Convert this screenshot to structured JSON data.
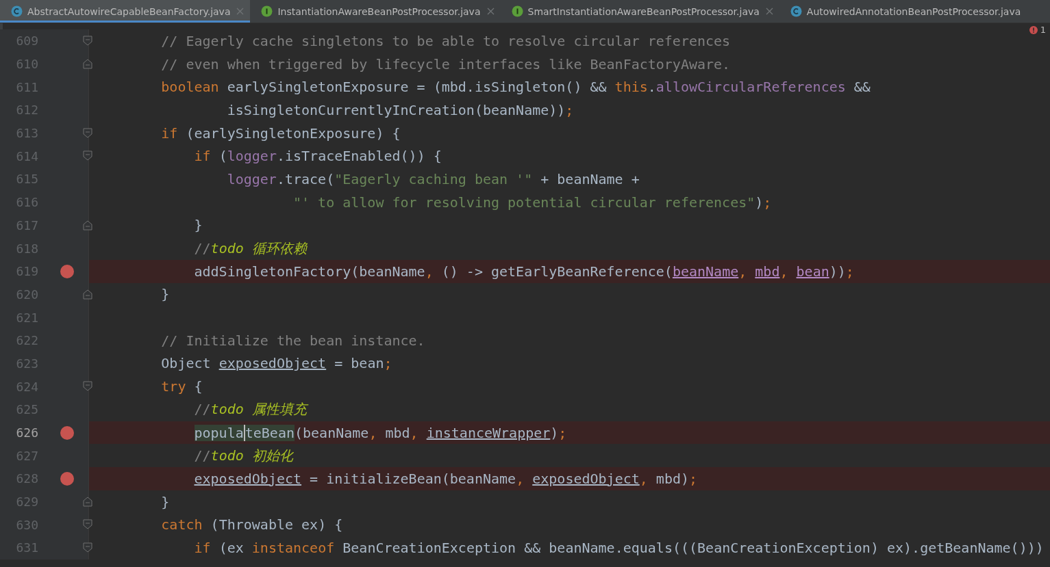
{
  "tabs": [
    {
      "label": "AbstractAutowireCapableBeanFactory.java",
      "kind": "class",
      "selected": true,
      "closable": true
    },
    {
      "label": "InstantiationAwareBeanPostProcessor.java",
      "kind": "interface",
      "selected": false,
      "closable": true
    },
    {
      "label": "SmartInstantiationAwareBeanPostProcessor.java",
      "kind": "interface",
      "selected": false,
      "closable": true
    },
    {
      "label": "AutowiredAnnotationBeanPostProcessor.java",
      "kind": "class",
      "selected": false,
      "closable": false
    }
  ],
  "problems": {
    "count": "1"
  },
  "lines": [
    {
      "number": "609",
      "kind": "fold-start",
      "breakpoint": false,
      "current": false,
      "tokens": [
        {
          "text": "        // Eagerly cache singletons to be able to resolve circular references",
          "kind": "comment"
        }
      ]
    },
    {
      "number": "610",
      "kind": "fold-end",
      "breakpoint": false,
      "current": false,
      "tokens": [
        {
          "text": "        // even when triggered by lifecycle interfaces like BeanFactoryAware.",
          "kind": "comment"
        }
      ]
    },
    {
      "number": "611",
      "kind": "plain",
      "breakpoint": false,
      "current": false,
      "tokens": [
        {
          "text": "        boolean",
          "kind": "keyword"
        },
        {
          "text": " earlySingletonExposure = (mbd.isSingleton() && ",
          "kind": "plain"
        },
        {
          "text": "this",
          "kind": "keyword"
        },
        {
          "text": ".",
          "kind": "plain"
        },
        {
          "text": "allowCircularReferences",
          "kind": "field"
        },
        {
          "text": " &&",
          "kind": "plain"
        }
      ]
    },
    {
      "number": "612",
      "kind": "plain",
      "breakpoint": false,
      "current": false,
      "tokens": [
        {
          "text": "                isSingletonCurrentlyInCreation(beanName))",
          "kind": "plain"
        },
        {
          "text": ";",
          "kind": "punct"
        }
      ]
    },
    {
      "number": "613",
      "kind": "fold-start",
      "breakpoint": false,
      "current": false,
      "tokens": [
        {
          "text": "        if",
          "kind": "keyword"
        },
        {
          "text": " (earlySingletonExposure) {",
          "kind": "plain"
        }
      ]
    },
    {
      "number": "614",
      "kind": "fold-start",
      "breakpoint": false,
      "current": false,
      "tokens": [
        {
          "text": "            if",
          "kind": "keyword"
        },
        {
          "text": " (",
          "kind": "plain"
        },
        {
          "text": "logger",
          "kind": "field"
        },
        {
          "text": ".isTraceEnabled()) {",
          "kind": "plain"
        }
      ]
    },
    {
      "number": "615",
      "kind": "plain",
      "breakpoint": false,
      "current": false,
      "tokens": [
        {
          "text": "                logger",
          "kind": "field"
        },
        {
          "text": ".trace(",
          "kind": "plain"
        },
        {
          "text": "\"Eagerly caching bean '\"",
          "kind": "string"
        },
        {
          "text": " + beanName +",
          "kind": "plain"
        }
      ]
    },
    {
      "number": "616",
      "kind": "plain",
      "breakpoint": false,
      "current": false,
      "tokens": [
        {
          "text": "                        \"' to allow for resolving potential circular references\"",
          "kind": "string"
        },
        {
          "text": ")",
          "kind": "plain"
        },
        {
          "text": ";",
          "kind": "punct"
        }
      ]
    },
    {
      "number": "617",
      "kind": "fold-end",
      "breakpoint": false,
      "current": false,
      "tokens": [
        {
          "text": "            }",
          "kind": "plain"
        }
      ]
    },
    {
      "number": "618",
      "kind": "plain",
      "breakpoint": false,
      "current": false,
      "tokens": [
        {
          "text": "            //",
          "kind": "comment"
        },
        {
          "text": "todo 循环依赖",
          "kind": "todo"
        }
      ]
    },
    {
      "number": "619",
      "kind": "plain",
      "breakpoint": true,
      "current": false,
      "tokens": [
        {
          "text": "            addSingletonFactory(beanName",
          "kind": "plain"
        },
        {
          "text": ",",
          "kind": "punct"
        },
        {
          "text": " () -> getEarlyBeanReference(",
          "kind": "plain"
        },
        {
          "text": "beanName",
          "kind": "captured"
        },
        {
          "text": ", ",
          "kind": "punct"
        },
        {
          "text": "mbd",
          "kind": "captured"
        },
        {
          "text": ", ",
          "kind": "punct"
        },
        {
          "text": "bean",
          "kind": "captured"
        },
        {
          "text": "))",
          "kind": "plain"
        },
        {
          "text": ";",
          "kind": "punct"
        }
      ]
    },
    {
      "number": "620",
      "kind": "fold-end",
      "breakpoint": false,
      "current": false,
      "tokens": [
        {
          "text": "        }",
          "kind": "plain"
        }
      ]
    },
    {
      "number": "621",
      "kind": "plain",
      "breakpoint": false,
      "current": false
    },
    {
      "number": "622",
      "kind": "plain",
      "breakpoint": false,
      "current": false,
      "tokens": [
        {
          "text": "        // Initialize the bean instance.",
          "kind": "comment"
        }
      ]
    },
    {
      "number": "623",
      "kind": "plain",
      "breakpoint": false,
      "current": false,
      "tokens": [
        {
          "text": "        Object ",
          "kind": "plain"
        },
        {
          "text": "exposedObject",
          "kind": "reassigned"
        },
        {
          "text": " = bean",
          "kind": "plain"
        },
        {
          "text": ";",
          "kind": "punct"
        }
      ]
    },
    {
      "number": "624",
      "kind": "fold-start",
      "breakpoint": false,
      "current": false,
      "tokens": [
        {
          "text": "        try",
          "kind": "keyword"
        },
        {
          "text": " {",
          "kind": "plain"
        }
      ]
    },
    {
      "number": "625",
      "kind": "plain",
      "breakpoint": false,
      "current": false,
      "tokens": [
        {
          "text": "            //",
          "kind": "comment"
        },
        {
          "text": "todo 属性填充",
          "kind": "todo"
        }
      ]
    },
    {
      "number": "626",
      "kind": "plain",
      "breakpoint": true,
      "current": true,
      "tokens": [
        {
          "text": "            popula",
          "kind": "highlight"
        },
        {
          "text": "teBean",
          "kind": "highlight-caret"
        },
        {
          "text": "(beanName",
          "kind": "plain"
        },
        {
          "text": ",",
          "kind": "punct"
        },
        {
          "text": " mbd",
          "kind": "plain"
        },
        {
          "text": ", ",
          "kind": "punct"
        },
        {
          "text": "instanceWrapper",
          "kind": "reassigned"
        },
        {
          "text": ")",
          "kind": "plain"
        },
        {
          "text": ";",
          "kind": "punct"
        }
      ]
    },
    {
      "number": "627",
      "kind": "plain",
      "breakpoint": false,
      "current": false,
      "tokens": [
        {
          "text": "            //",
          "kind": "comment"
        },
        {
          "text": "todo 初始化",
          "kind": "todo"
        }
      ]
    },
    {
      "number": "628",
      "kind": "plain",
      "breakpoint": true,
      "current": false,
      "tokens": [
        {
          "text": "            exposedObject",
          "kind": "reassigned"
        },
        {
          "text": " = initializeBean(beanName",
          "kind": "plain"
        },
        {
          "text": ", ",
          "kind": "punct"
        },
        {
          "text": "exposedObject",
          "kind": "reassigned"
        },
        {
          "text": ",",
          "kind": "punct"
        },
        {
          "text": " mbd)",
          "kind": "plain"
        },
        {
          "text": ";",
          "kind": "punct"
        }
      ]
    },
    {
      "number": "629",
      "kind": "fold-end",
      "breakpoint": false,
      "current": false,
      "tokens": [
        {
          "text": "        }",
          "kind": "plain"
        }
      ]
    },
    {
      "number": "630",
      "kind": "fold-start",
      "breakpoint": false,
      "current": false,
      "tokens": [
        {
          "text": "        catch",
          "kind": "keyword"
        },
        {
          "text": " (Throwable ex) {",
          "kind": "plain"
        }
      ]
    },
    {
      "number": "631",
      "kind": "fold-start",
      "breakpoint": false,
      "current": false,
      "tokens": [
        {
          "text": "            if",
          "kind": "keyword"
        },
        {
          "text": " (ex ",
          "kind": "plain"
        },
        {
          "text": "instanceof",
          "kind": "keyword"
        },
        {
          "text": " BeanCreationException && beanName.equals(((BeanCreationException) ex).getBeanName()))",
          "kind": "plain"
        }
      ]
    }
  ]
}
